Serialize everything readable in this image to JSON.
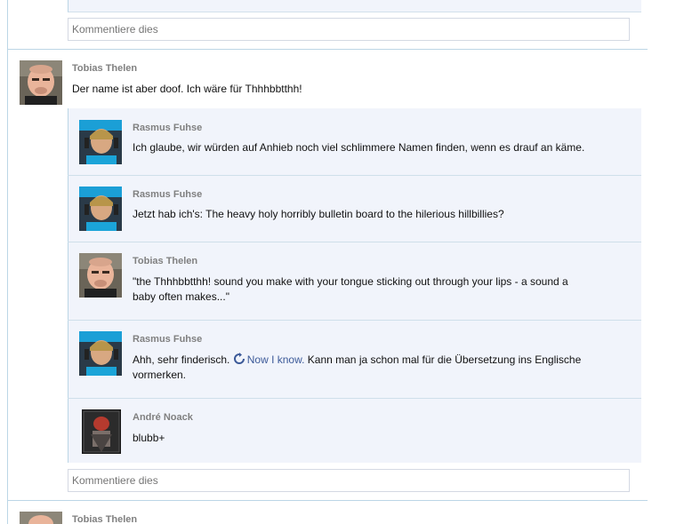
{
  "placeholder": "Kommentiere dies",
  "post": {
    "author": "Tobias Thelen",
    "text": "Der name ist aber doof. Ich wäre für Thhhbbtthh!"
  },
  "replies": [
    {
      "author": "Rasmus Fuhse",
      "text": "Ich glaube, wir würden auf Anhieb noch viel schlimmere Namen finden, wenn es drauf an käme."
    },
    {
      "author": "Rasmus Fuhse",
      "text": "Jetzt hab ich's: The heavy holy horribly bulletin board to the hilerious hillbillies?"
    },
    {
      "author": "Tobias Thelen",
      "text_line1": "\"the Thhhbbtthh! sound you make with your tongue sticking out through your lips - a sound a",
      "text_line2": "baby often makes...\""
    },
    {
      "author": "Rasmus Fuhse",
      "text_before": "Ahh, sehr finderisch.",
      "link": "Now I know.",
      "text_after": "Kann man ja schon mal für die Übersetzung ins Englische",
      "text_line2": "vormerken."
    },
    {
      "author": "André Noack",
      "text": "blubb+"
    }
  ],
  "next_post": {
    "author": "Tobias Thelen"
  },
  "colors": {
    "accent_link": "#3b5998",
    "reply_bg": "#f1f4fb",
    "rule": "#bcd6e6"
  },
  "icons": [
    "reload-icon"
  ]
}
